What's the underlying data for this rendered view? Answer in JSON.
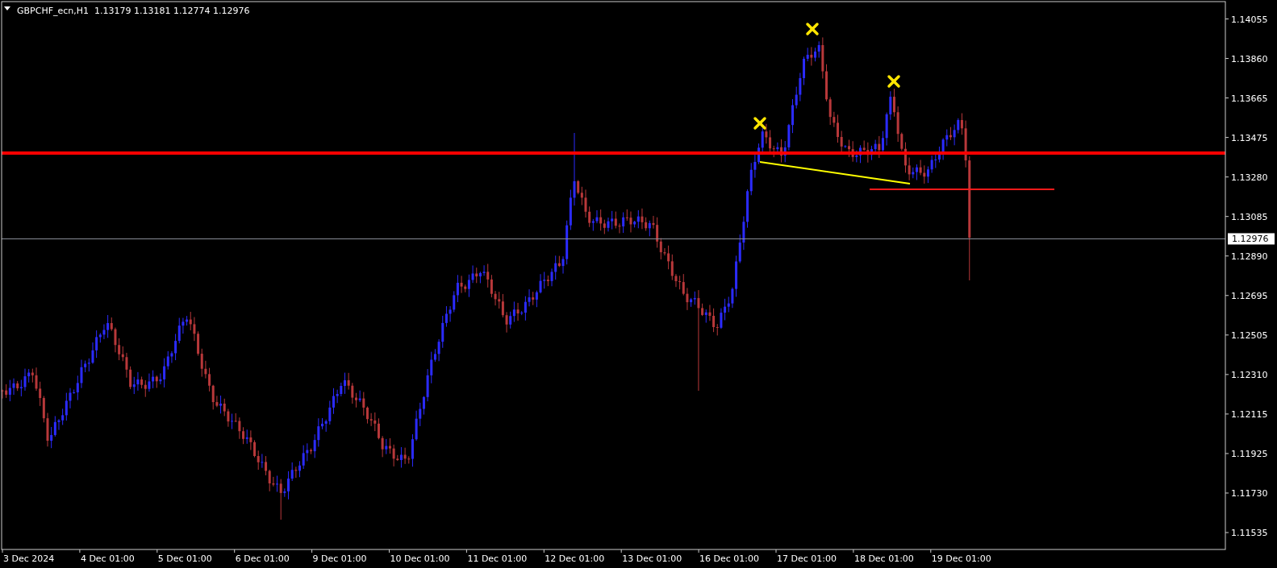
{
  "chart": {
    "symbol": "GBPCHF_ecn,H1",
    "ohlc": "1.13179 1.13181 1.12774 1.12976"
  },
  "price_axis": {
    "ticks": [
      "1.14055",
      "1.13860",
      "1.13665",
      "1.13475",
      "1.13280",
      "1.13085",
      "1.12890",
      "1.12695",
      "1.12505",
      "1.12310",
      "1.12115",
      "1.11925",
      "1.11730",
      "1.11535"
    ],
    "current_price": "1.12976"
  },
  "time_axis": {
    "labels": [
      "3 Dec 2024",
      "4 Dec 01:00",
      "5 Dec 01:00",
      "6 Dec 01:00",
      "9 Dec 01:00",
      "10 Dec 01:00",
      "11 Dec 01:00",
      "12 Dec 01:00",
      "13 Dec 01:00",
      "16 Dec 01:00",
      "17 Dec 01:00",
      "18 Dec 01:00",
      "19 Dec 01:00"
    ]
  }
}
